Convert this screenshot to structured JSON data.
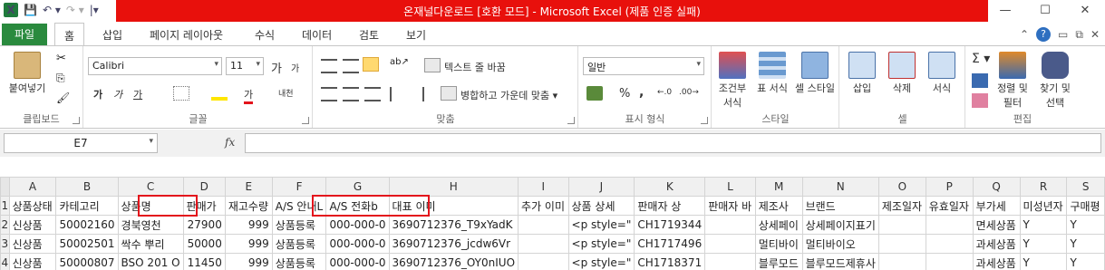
{
  "titlebar": {
    "title": "온재널다운로드 [호환 모드] - Microsoft Excel (제품 인증 실패)",
    "minimize": "—",
    "restore": "☐",
    "close": "✕"
  },
  "tabs": {
    "file": "파일",
    "items": [
      "홈",
      "삽입",
      "페이지 레이아웃",
      "수식",
      "데이터",
      "검토",
      "보기"
    ],
    "active": "홈"
  },
  "ribbon": {
    "clipboard": {
      "paste": "붙여넣기",
      "label": "클립보드"
    },
    "font": {
      "name": "Calibri",
      "size": "11",
      "label": "글꼴",
      "bold": "가",
      "italic": "가",
      "underline": "가",
      "grow": "가",
      "shrink": "가",
      "fontcolor": "가",
      "phonetic": "내천"
    },
    "alignment": {
      "wrap": "텍스트 줄 바꿈",
      "merge": "병합하고 가운데 맞춤",
      "label": "맞춤"
    },
    "number": {
      "format": "일반",
      "percent": "%",
      "comma": ",",
      "label": "표시 형식"
    },
    "styles": {
      "conditional": "조건부 서식",
      "table": "표 서식",
      "cell": "셀 스타일",
      "label": "스타일"
    },
    "cells": {
      "insert": "삽입",
      "delete": "삭제",
      "format": "서식",
      "label": "셀"
    },
    "editing": {
      "sort": "정렬 및 필터",
      "find": "찾기 및 선택",
      "label": "편집",
      "sum": "Σ"
    }
  },
  "formula_bar": {
    "name_box": "E7",
    "fx": "fx",
    "value": ""
  },
  "grid": {
    "columns": [
      "A",
      "B",
      "C",
      "D",
      "E",
      "F",
      "G",
      "H",
      "I",
      "J",
      "K",
      "L",
      "M",
      "N",
      "O",
      "P",
      "Q",
      "R",
      "S"
    ],
    "rows": [
      [
        "1",
        "상품상태",
        "카테고리",
        "상품명",
        "판매가",
        "재고수량",
        "A/S 안내L",
        "A/S 전화b",
        "대표 이미",
        "추가 이미",
        "상품 상세",
        "판매자 상",
        "판매자 바",
        "제조사",
        "브랜드",
        "제조일자",
        "유효일자",
        "부가세",
        "미성년자",
        "구매평"
      ],
      [
        "2",
        "신상품",
        "50002160",
        "경북영천",
        "27900",
        "999",
        "상품등록",
        "000-000-0",
        "3690712376_T9xYadK",
        "",
        "<p style=\"",
        "CH1719344",
        "",
        "상세페이",
        "상세페이지표기",
        "",
        "",
        "면세상품",
        "Y",
        "Y"
      ],
      [
        "3",
        "신상품",
        "50002501",
        "싹수 뿌리",
        "50000",
        "999",
        "상품등록",
        "000-000-0",
        "3690712376_jcdw6Vr",
        "",
        "<p style=\"",
        "CH1717496",
        "",
        "멀티바이",
        "멀티바이오",
        "",
        "",
        "과세상품",
        "Y",
        "Y"
      ],
      [
        "4",
        "신상품",
        "50000807",
        "BSO 201 O",
        "11450",
        "999",
        "상품등록",
        "000-000-0",
        "3690712376_OY0nIUO",
        "",
        "<p style=\"",
        "CH1718371",
        "",
        "블루모드",
        "블루모드제휴사",
        "",
        "",
        "과세상품",
        "Y",
        "Y"
      ]
    ]
  },
  "colors": {
    "titlebar_red": "#e8100c",
    "file_tab": "#2a8a3e",
    "highlight_box": "#e3141c"
  }
}
